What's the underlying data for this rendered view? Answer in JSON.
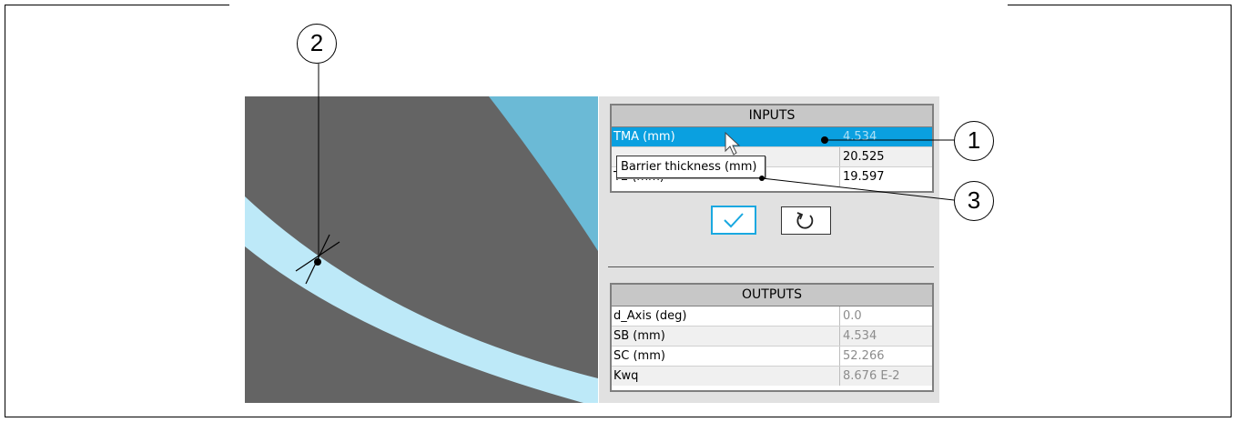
{
  "inputs": {
    "title": "INPUTS",
    "rows": [
      {
        "label": "TMA (mm)",
        "value": "4.534"
      },
      {
        "label": "",
        "value": "20.525"
      },
      {
        "label": "T2 (mm)",
        "value": "19.597"
      }
    ]
  },
  "tooltip": "Barrier thickness (mm)",
  "outputs": {
    "title": "OUTPUTS",
    "rows": [
      {
        "label": "d_Axis (deg)",
        "value": "0.0"
      },
      {
        "label": "SB (mm)",
        "value": "4.534"
      },
      {
        "label": "SC (mm)",
        "value": "52.266"
      },
      {
        "label": "Kwq",
        "value": "8.676 E-2"
      }
    ]
  },
  "buttons": {
    "apply_icon": "checkmark-icon",
    "reset_icon": "reset-icon"
  },
  "callouts": {
    "one": "1",
    "two": "2",
    "three": "3"
  },
  "colors": {
    "dark_region": "#646464",
    "light_band": "#bde9f8",
    "corner_blue": "#6bbad6",
    "selection": "#0aa0e0"
  }
}
